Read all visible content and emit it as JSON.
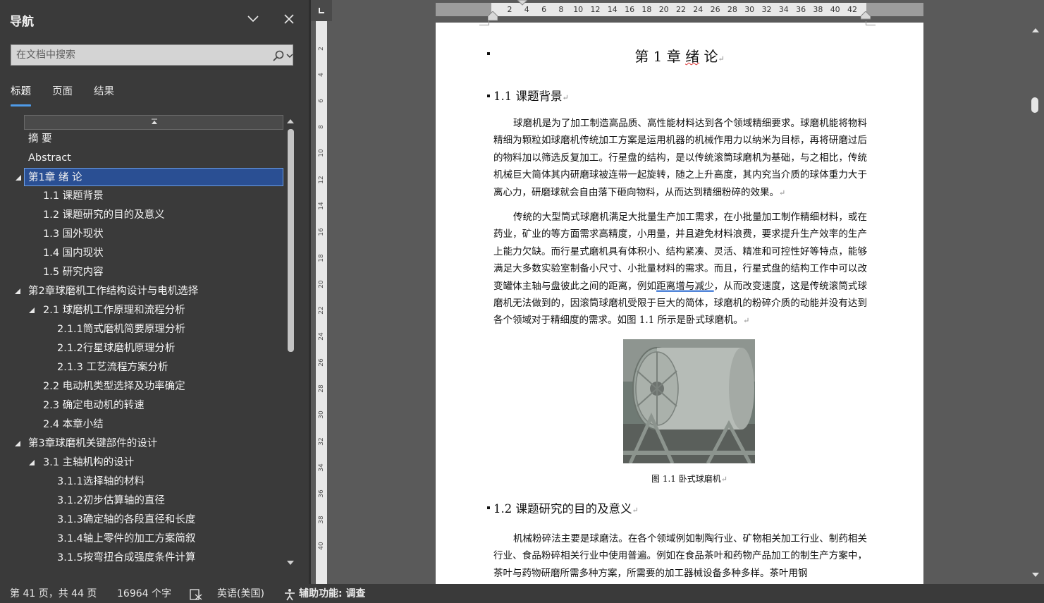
{
  "nav": {
    "title": "导航",
    "search_placeholder": "在文档中搜索",
    "tabs": [
      "标题",
      "页面",
      "结果"
    ],
    "active_tab": "标题",
    "tree": [
      {
        "label": "摘  要",
        "level": 0,
        "arrow": false
      },
      {
        "label": "Abstract",
        "level": 0,
        "arrow": false
      },
      {
        "label": "第1章 绪  论",
        "level": 0,
        "arrow": true,
        "selected": true
      },
      {
        "label": "1.1 课题背景",
        "level": 1,
        "arrow": false
      },
      {
        "label": "1.2 课题研究的目的及意义",
        "level": 1,
        "arrow": false
      },
      {
        "label": "1.3 国外现状",
        "level": 1,
        "arrow": false
      },
      {
        "label": "1.4 国内现状",
        "level": 1,
        "arrow": false
      },
      {
        "label": "1.5 研究内容",
        "level": 1,
        "arrow": false
      },
      {
        "label": "第2章球磨机工作结构设计与电机选择",
        "level": 0,
        "arrow": true
      },
      {
        "label": "2.1 球磨机工作原理和流程分析",
        "level": 1,
        "arrow": true
      },
      {
        "label": "2.1.1筒式磨机简要原理分析",
        "level": 2,
        "arrow": false
      },
      {
        "label": "2.1.2行星球磨机原理分析",
        "level": 2,
        "arrow": false
      },
      {
        "label": "2.1.3 工艺流程方案分析",
        "level": 2,
        "arrow": false
      },
      {
        "label": "2.2 电动机类型选择及功率确定",
        "level": 1,
        "arrow": false
      },
      {
        "label": "2.3 确定电动机的转速",
        "level": 1,
        "arrow": false
      },
      {
        "label": "2.4 本章小结",
        "level": 1,
        "arrow": false
      },
      {
        "label": "第3章球磨机关键部件的设计",
        "level": 0,
        "arrow": true
      },
      {
        "label": "3.1 主轴机构的设计",
        "level": 1,
        "arrow": true
      },
      {
        "label": "3.1.1选择轴的材料",
        "level": 2,
        "arrow": false
      },
      {
        "label": "3.1.2初步估算轴的直径",
        "level": 2,
        "arrow": false
      },
      {
        "label": "3.1.3确定轴的各段直径和长度",
        "level": 2,
        "arrow": false
      },
      {
        "label": "3.1.4轴上零件的加工方案简叙",
        "level": 2,
        "arrow": false
      },
      {
        "label": "3.1.5按弯扭合成强度条件计算",
        "level": 2,
        "arrow": false
      }
    ]
  },
  "ruler": {
    "h_numbers": [
      "2",
      "4",
      "6",
      "8",
      "10",
      "12",
      "14",
      "16",
      "18",
      "20",
      "22",
      "24",
      "26",
      "28",
      "30",
      "32",
      "34",
      "36",
      "38",
      "40",
      "42"
    ],
    "v_numbers": [
      "2",
      "4",
      "6",
      "8",
      "10",
      "12",
      "14",
      "16",
      "18",
      "20",
      "22",
      "24",
      "26",
      "28",
      "30",
      "32",
      "34",
      "36",
      "38",
      "40"
    ]
  },
  "document": {
    "chapter_title_a": "第 1 章 ",
    "chapter_title_b": "绪",
    "chapter_title_c": " 论",
    "section_1_1": "1.1 课题背景",
    "para1": "球磨机是为了加工制造高品质、高性能材料达到各个领域精细要求。球磨机能将物料精细为颗粒如球磨机传统加工方案是运用机器的机械作用力以纳米为目标，再将研磨过后的物料加以筛选反复加工。行星盘的结构，是以传统滚筒球磨机为基础，与之相比，传统机械巨大简体其内研磨球被连带一起旋转，随之上升高度，其内究当介质的球体重力大于离心力，研磨球就会自由落下砸向物料，从而达到精细粉碎的效果。",
    "para2_a": "传统的大型筒式球磨机满足大批量生产加工需求，在小批量加工制作精细材料，或在药业，矿业的等方面需求高精度，小用量，并且避免材料浪费，要求提升生产效率的生产上能力欠缺。而行星式磨机具有体积小、结构紧凑、灵活、精准和可控性好等特点，能够满足大多数实验室制备小尺寸、小批量材料的需求。而且，行星式盘的结构工作中可以改变罐体主轴与盘彼此之间的距离，例如",
    "para2_b": "距离增与减少",
    "para2_c": "，从而改变速度，这是传统滚筒式球磨机无法做到的，因滚筒球磨机受限于巨大的简体，球磨机的粉碎介质的动能并没有达到各个领域对于精细度的需求。如图 1.1 所示是卧式球磨机。",
    "figure_caption": "图 1.1 卧式球磨机",
    "section_1_2": "1.2 课题研究的目的及意义",
    "para3": "机械粉碎法主要是球磨法。在各个领域例如制陶行业、矿物相关加工行业、制药相关行业、食品粉碎相关行业中使用普遍。例如在食品茶叶和药物产品加工的制生产方案中，茶叶与药物研磨所需多种方案，所需要的加工器械设备多种多样。茶叶用钢",
    "para_mark": "↵"
  },
  "status": {
    "page": "第 41 页，共 44 页",
    "words": "16964 个字",
    "language": "英语(美国)",
    "accessibility": "辅助功能: 调查"
  }
}
